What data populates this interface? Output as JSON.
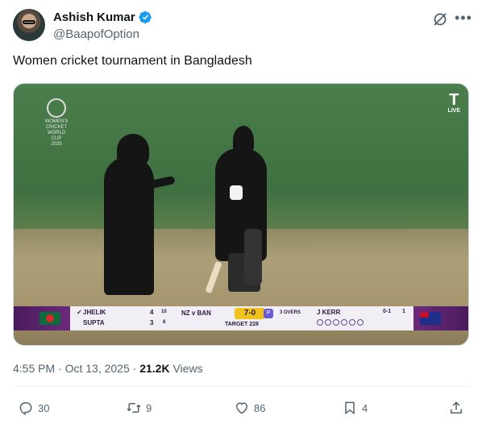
{
  "author": {
    "name": "Ashish Kumar",
    "handle": "@BaapofOption",
    "verified": true
  },
  "tweet": {
    "text": "Women cricket tournament in Bangladesh"
  },
  "media": {
    "broadcaster_logo": "T",
    "live_label": "LIVE",
    "tournament_logo": "WOMEN'S CRICKET WORLD CUP 2025",
    "scoreboard": {
      "batter1": "JHELIK",
      "batter1_runs": "4",
      "batter1_balls": "10",
      "batter2": "SUPTA",
      "batter2_runs": "3",
      "batter2_balls": "8",
      "match": "NZ v BAN",
      "score": "7-0",
      "powerplay": "P",
      "overs": "3 OVERS",
      "target": "TARGET 228",
      "bowler": "J KERR",
      "bowler_figures": "0-1",
      "bowler_overs": "1"
    }
  },
  "meta": {
    "time": "4:55 PM",
    "separator": "·",
    "date": "Oct 13, 2025",
    "views_count": "21.2K",
    "views_label": "Views"
  },
  "actions": {
    "replies": "30",
    "reposts": "9",
    "likes": "86",
    "bookmarks": "4"
  },
  "colors": {
    "text": "#0f1419",
    "secondary": "#536471",
    "verified": "#1d9bf0"
  }
}
